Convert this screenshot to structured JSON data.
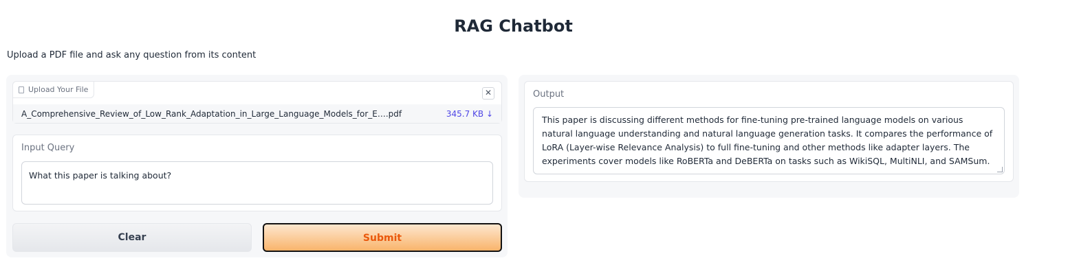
{
  "header": {
    "title": "RAG Chatbot",
    "description": "Upload a PDF file and ask any question from its content"
  },
  "file_upload": {
    "label": "Upload Your File",
    "file_name": "A_Comprehensive_Review_of_Low_Rank_Adaptation_in_Large_Language_Models_for_E….pdf",
    "file_size": "345.7 KB ↓",
    "close_symbol": "✕",
    "icons": {
      "file": "file-icon",
      "close": "close-icon"
    }
  },
  "query": {
    "label": "Input Query",
    "value": "What this paper is talking about?"
  },
  "buttons": {
    "clear": "Clear",
    "submit": "Submit"
  },
  "output": {
    "label": "Output",
    "value": "This paper is discussing different methods for fine-tuning pre-trained language models on various natural language understanding and natural language generation tasks. It compares the performance of LoRA (Layer-wise Relevance Analysis) to full fine-tuning and other methods like adapter layers. The experiments cover models like RoBERTa and DeBERTa on tasks such as WikiSQL, MultiNLI, and SAMSum."
  },
  "colors": {
    "submit_text": "#ea580c",
    "submit_gradient_start": "#fde7cf",
    "submit_gradient_end": "#f9b46b",
    "file_size_link": "#4f46e5",
    "panel_bg": "#f6f7f9"
  }
}
